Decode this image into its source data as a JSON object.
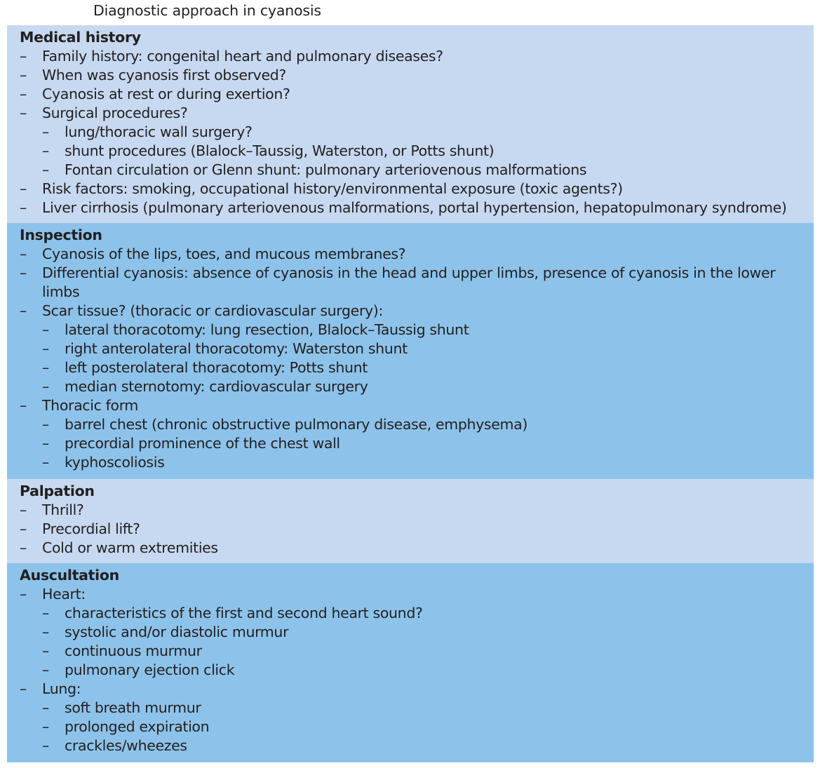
{
  "title": "Diagnostic approach in cyanosis",
  "colors": {
    "light_section": "#c6d9f0",
    "medium_section": "#8dc3ea",
    "text": "#231f20"
  },
  "bullet_glyph": "–",
  "sections": [
    {
      "heading": "Medical history",
      "shade": "light",
      "items": [
        {
          "level": 1,
          "text": "Family history: congenital heart and pulmonary diseases?"
        },
        {
          "level": 1,
          "text": "When was cyanosis first observed?"
        },
        {
          "level": 1,
          "text": "Cyanosis at rest or during exertion?"
        },
        {
          "level": 1,
          "text": "Surgical procedures?"
        },
        {
          "level": 2,
          "text": "lung/thoracic wall surgery?"
        },
        {
          "level": 2,
          "text": "shunt procedures (Blalock–Taussig, Waterston, or Potts shunt)"
        },
        {
          "level": 2,
          "text": "Fontan circulation or Glenn shunt: pulmonary arteriovenous malformations"
        },
        {
          "level": 1,
          "text": "Risk factors: smoking, occupational history/environmental exposure (toxic agents?)"
        },
        {
          "level": 1,
          "text": "Liver cirrhosis (pulmonary arteriovenous malformations, portal hypertension, hepatopulmonary syndrome)"
        }
      ]
    },
    {
      "heading": "Inspection",
      "shade": "medium",
      "items": [
        {
          "level": 1,
          "text": "Cyanosis of the lips, toes, and mucous membranes?"
        },
        {
          "level": 1,
          "text": "Differential cyanosis: absence of cyanosis in the head and upper limbs, presence of cyanosis in the lower limbs"
        },
        {
          "level": 1,
          "text": "Scar tissue? (thoracic or cardiovascular surgery):"
        },
        {
          "level": 2,
          "text": "lateral thoracotomy: lung resection, Blalock–Taussig shunt"
        },
        {
          "level": 2,
          "text": "right anterolateral thoracotomy: Waterston shunt"
        },
        {
          "level": 2,
          "text": "left posterolateral thoracotomy: Potts shunt"
        },
        {
          "level": 2,
          "text": "median sternotomy: cardiovascular surgery"
        },
        {
          "level": 1,
          "text": "Thoracic form"
        },
        {
          "level": 2,
          "text": "barrel chest (chronic obstructive pulmonary disease, emphysema)"
        },
        {
          "level": 2,
          "text": "precordial prominence of the chest wall"
        },
        {
          "level": 2,
          "text": "kyphoscoliosis"
        }
      ]
    },
    {
      "heading": "Palpation",
      "shade": "light",
      "items": [
        {
          "level": 1,
          "text": "Thrill?"
        },
        {
          "level": 1,
          "text": "Precordial lift?"
        },
        {
          "level": 1,
          "text": "Cold or warm extremities"
        }
      ]
    },
    {
      "heading": "Auscultation",
      "shade": "medium",
      "items": [
        {
          "level": 1,
          "text": "Heart:"
        },
        {
          "level": 2,
          "text": "characteristics of the first and second heart sound?"
        },
        {
          "level": 2,
          "text": "systolic and/or diastolic murmur"
        },
        {
          "level": 2,
          "text": "continuous murmur"
        },
        {
          "level": 2,
          "text": "pulmonary ejection click"
        },
        {
          "level": 1,
          "text": "Lung:"
        },
        {
          "level": 2,
          "text": "soft breath murmur"
        },
        {
          "level": 2,
          "text": "prolonged expiration"
        },
        {
          "level": 2,
          "text": "crackles/wheezes"
        }
      ]
    }
  ]
}
